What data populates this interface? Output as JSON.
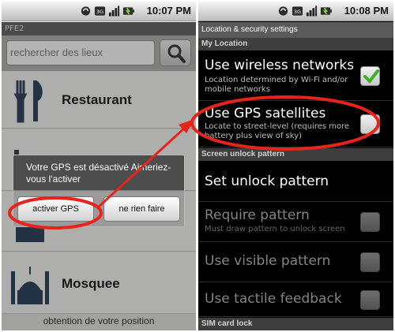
{
  "left_screen": {
    "status_time": "10:07 PM",
    "status_network_badge": "3G",
    "app_title": "PFE2",
    "search": {
      "placeholder": "rechercher des lieux"
    },
    "categories": [
      {
        "label": "Restaurant",
        "icon": "fork-knife-icon"
      },
      {
        "label": "",
        "icon": "hotel-icon"
      },
      {
        "label": "",
        "icon": "building-icon"
      },
      {
        "label": "Mosquee",
        "icon": "mosque-icon"
      }
    ],
    "footer_text": "obtention de votre position",
    "dialog": {
      "message": "Votre GPS est désactivé Aimeriez-vous l'activer",
      "positive_label": "activer GPS",
      "negative_label": "ne rien faire"
    }
  },
  "right_screen": {
    "status_time": "10:08 PM",
    "status_network_badge": "3G",
    "title": "Location & security settings",
    "sections": {
      "my_location": "My Location",
      "screen_unlock": "Screen unlock pattern",
      "sim": "SIM card lock"
    },
    "items": [
      {
        "title": "Use wireless networks",
        "summary": "Location determined by Wi-Fi and/or mobile networks",
        "checked": true,
        "enabled": true
      },
      {
        "title": "Use GPS satellites",
        "summary": "Locate to street-level (requires more battery plus view of sky)",
        "checked": false,
        "enabled": true
      },
      {
        "title": "Set unlock pattern",
        "summary": "",
        "checked": null,
        "enabled": true
      },
      {
        "title": "Require pattern",
        "summary": "Must draw pattern to unlock screen",
        "checked": false,
        "enabled": false
      },
      {
        "title": "Use visible pattern",
        "summary": "",
        "checked": false,
        "enabled": false
      },
      {
        "title": "Use tactile feedback",
        "summary": "",
        "checked": false,
        "enabled": false
      }
    ]
  },
  "colors": {
    "annotation_red": "#e8231b",
    "check_green": "#3fae2a"
  }
}
